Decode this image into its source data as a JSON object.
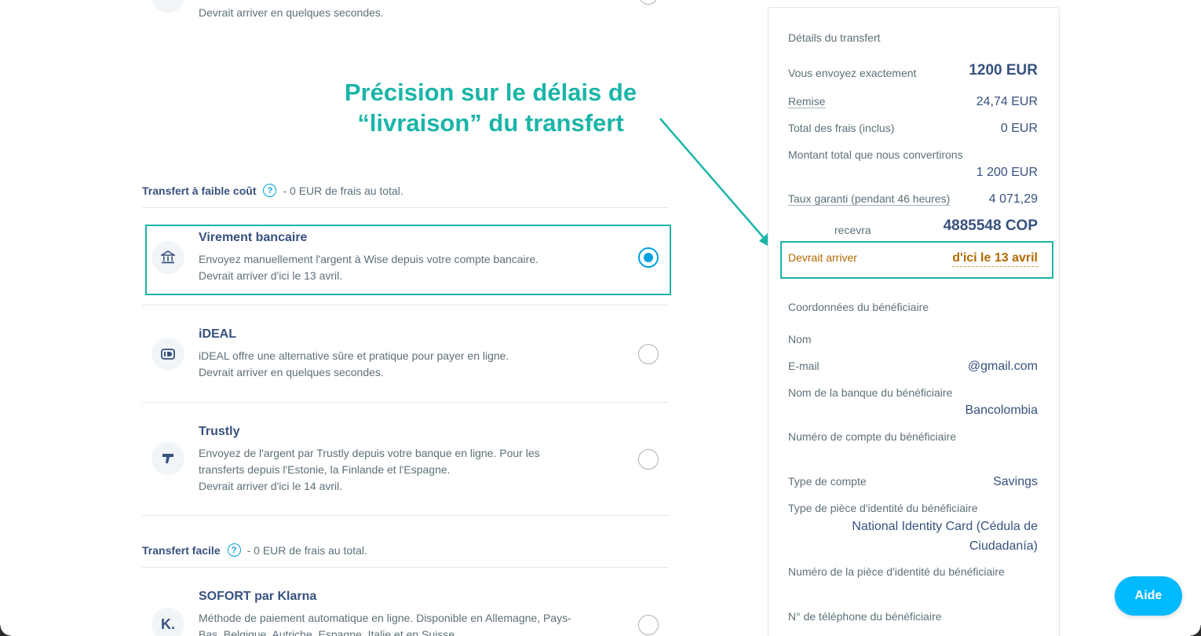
{
  "top_option": {
    "desc_line": "Devrait arriver en quelques secondes."
  },
  "low_cost": {
    "title": "Transfert à faible coût",
    "help": "?",
    "fee": "- 0 EUR de frais au total."
  },
  "options_low": [
    {
      "name": "Virement bancaire",
      "icon": "bank-icon",
      "desc1": "Envoyez manuellement l'argent à Wise depuis votre compte bancaire.",
      "desc2": "Devrait arriver d'ici le 13 avril.",
      "selected": true
    },
    {
      "name": "iDEAL",
      "icon": "ideal-icon",
      "desc1": "iDEAL offre une alternative sûre et pratique pour payer en ligne.",
      "desc2": "Devrait arriver en quelques secondes.",
      "selected": false
    },
    {
      "name": "Trustly",
      "icon": "trustly-icon",
      "desc1": "Envoyez de l'argent par Trustly depuis votre banque en ligne. Pour les",
      "desc2": "transferts depuis l'Estonie, la Finlande et l'Espagne.",
      "desc3": "Devrait arriver d'ici le 14 avril.",
      "selected": false
    }
  ],
  "easy": {
    "title": "Transfert facile",
    "help": "?",
    "fee": "- 0 EUR de frais au total."
  },
  "options_easy": [
    {
      "name": "SOFORT par Klarna",
      "icon": "klarna-icon",
      "icon_glyph": "K.",
      "desc1": "Méthode de paiement automatique en ligne. Disponible en Allemagne, Pays-",
      "desc2": "Bas, Belgique, Autriche, Espagne, Italie et en Suisse.",
      "selected": false
    }
  ],
  "annotation": {
    "line1": "Précision sur le délais de",
    "line2": "“livraison” du transfert"
  },
  "details": {
    "heading": "Détails du transfert",
    "send_label": "Vous envoyez exactement",
    "send_value": "1200 EUR",
    "discount_label": "Remise",
    "discount_value": "24,74 EUR",
    "fees_label": "Total des frais (inclus)",
    "fees_value": "0 EUR",
    "convert_label": "Montant total que nous convertirons",
    "convert_value": "1 200 EUR",
    "rate_label": "Taux garanti (pendant 46 heures)",
    "rate_value": "4 071,29",
    "receive_label": "recevra",
    "receive_value": "4885548 COP",
    "arrive_label": "Devrait arriver",
    "arrive_value": "d'ici le 13 avril"
  },
  "recipient": {
    "heading": "Coordonnées du bénéficiaire",
    "name_label": "Nom",
    "email_label": "E-mail",
    "email_value": "@gmail.com",
    "bank_label": "Nom de la banque du bénéficiaire",
    "bank_value": "Bancolombia",
    "account_label": "Numéro de compte du bénéficiaire",
    "type_label": "Type de compte",
    "type_value": "Savings",
    "id_type_label": "Type de pièce d'identité du bénéficiaire",
    "id_type_value": "National Identity Card (Cédula de Ciudadanía)",
    "id_num_label": "Numéro de la pièce d'identité du bénéficiaire",
    "phone_label": "N° de téléphone du bénéficiaire"
  },
  "help_button": "Aide",
  "colors": {
    "accent": "#00a2dd",
    "annotation": "#1ab5a8",
    "text": "#37517e",
    "warning": "#b26900"
  }
}
